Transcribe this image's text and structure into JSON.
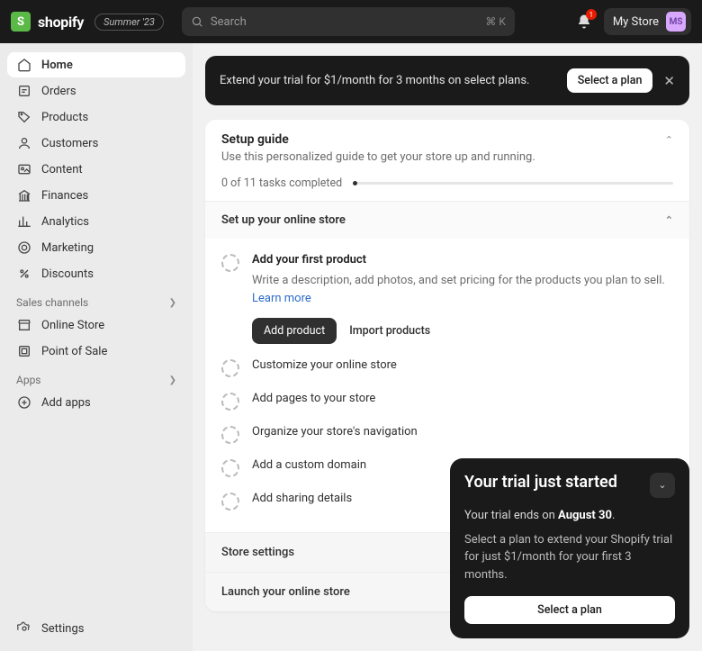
{
  "topbar": {
    "brand": "shopify",
    "badge": "Summer '23",
    "search_placeholder": "Search",
    "search_kbd": "⌘ K",
    "notif_count": "1",
    "store_name": "My Store",
    "avatar": "MS"
  },
  "sidebar": {
    "items": [
      "Home",
      "Orders",
      "Products",
      "Customers",
      "Content",
      "Finances",
      "Analytics",
      "Marketing",
      "Discounts"
    ],
    "channels_header": "Sales channels",
    "channels": [
      "Online Store",
      "Point of Sale"
    ],
    "apps_header": "Apps",
    "apps": [
      "Add apps"
    ],
    "settings": "Settings"
  },
  "banner": {
    "text": "Extend your trial for $1/month for 3 months on select plans.",
    "cta": "Select a plan"
  },
  "guide": {
    "title": "Setup guide",
    "subtitle": "Use this personalized guide to get your store up and running.",
    "progress": "0 of 11 tasks completed",
    "section1": "Set up your online store",
    "tasks": [
      {
        "title": "Add your first product",
        "desc": "Write a description, add photos, and set pricing for the products you plan to sell. ",
        "learn": "Learn more",
        "primary": "Add product",
        "secondary": "Import products"
      },
      {
        "title": "Customize your online store"
      },
      {
        "title": "Add pages to your store"
      },
      {
        "title": "Organize your store's navigation"
      },
      {
        "title": "Add a custom domain"
      },
      {
        "title": "Add sharing details"
      }
    ],
    "section2": "Store settings",
    "section3": "Launch your online store"
  },
  "popover": {
    "title": "Your trial just started",
    "line_pre": "Your trial ends on ",
    "line_bold": "August 30",
    "line_post": ".",
    "desc": "Select a plan to extend your Shopify trial for just $1/month for your first 3 months.",
    "cta": "Select a plan"
  }
}
